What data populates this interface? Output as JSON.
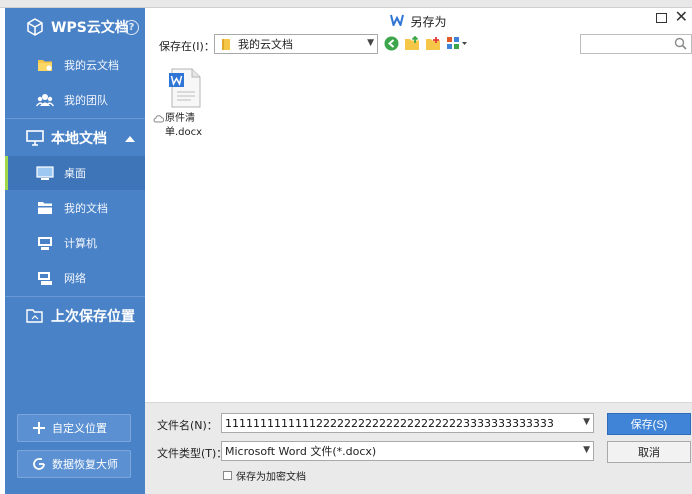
{
  "sidebar": {
    "cloud_title": "WPS云文档",
    "help": "?",
    "cloud_items": [
      {
        "label": "我的云文档",
        "icon": "cloud-folder-icon"
      },
      {
        "label": "我的团队",
        "icon": "team-icon"
      }
    ],
    "local_title": "本地文档",
    "local_items": [
      {
        "label": "桌面",
        "icon": "desktop-icon"
      },
      {
        "label": "我的文档",
        "icon": "my-documents-icon"
      },
      {
        "label": "计算机",
        "icon": "computer-icon"
      },
      {
        "label": "网络",
        "icon": "network-icon"
      }
    ],
    "last_save_title": "上次保存位置",
    "custom_location_button": "自定义位置",
    "data_recovery_button": "数据恢复大师"
  },
  "dialog": {
    "title": "另存为",
    "save_in_label": "保存在(I)：",
    "save_in_value": "我的云文档",
    "search_placeholder": "",
    "files": [
      {
        "name": "原件清单.docx",
        "icon": "word-doc-icon",
        "status": "cloud-icon"
      }
    ],
    "filename_label": "文件名(N)：",
    "filename_value": "11111111111112222222222222222222223333333333333",
    "filetype_label": "文件类型(T)：",
    "filetype_value": "Microsoft Word 文件(*.docx)",
    "save_button": "保存(S)",
    "cancel_button": "取消",
    "encrypt_checkbox": "保存为加密文档"
  },
  "colors": {
    "sidebar": "#4a82c7",
    "sidebar_active": "#3e74b8",
    "active_marker": "#9fd84a",
    "primary_button": "#3f84d6"
  }
}
